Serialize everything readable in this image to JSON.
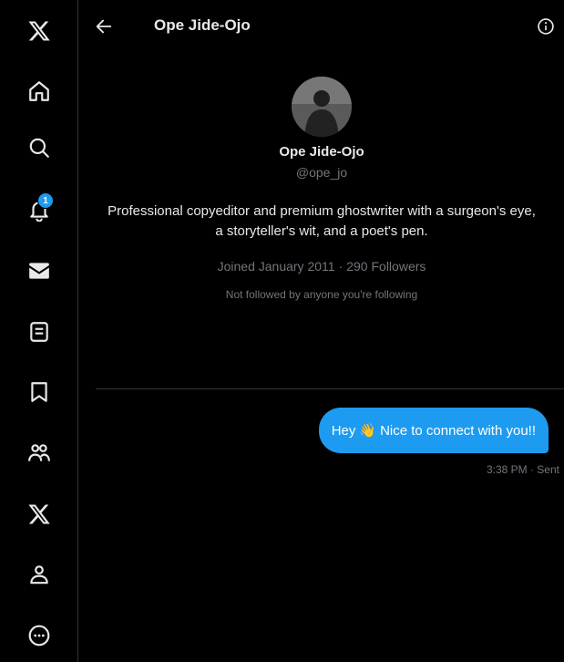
{
  "sidebar": {
    "items": [
      {
        "icon": "x-logo-icon"
      },
      {
        "icon": "home-icon"
      },
      {
        "icon": "search-icon"
      },
      {
        "icon": "notifications-icon",
        "badge": "1"
      },
      {
        "icon": "messages-icon"
      },
      {
        "icon": "lists-icon"
      },
      {
        "icon": "bookmarks-icon"
      },
      {
        "icon": "communities-icon"
      },
      {
        "icon": "premium-x-icon"
      },
      {
        "icon": "profile-icon"
      },
      {
        "icon": "more-icon"
      }
    ]
  },
  "header": {
    "title": "Ope Jide-Ojo"
  },
  "profile": {
    "name": "Ope Jide-Ojo",
    "handle": "@ope_jo",
    "bio": "Professional copyeditor and premium ghostwriter with a surgeon's eye, a storyteller's wit, and a poet's pen.",
    "joined": "Joined January 2011",
    "separator": "·",
    "followers": "290 Followers",
    "not_followed": "Not followed by anyone you're following"
  },
  "message": {
    "prefix": "Hey",
    "emoji": "👋",
    "suffix": "Nice to connect with you!!",
    "meta": "3:38 PM · Sent"
  },
  "colors": {
    "accent": "#1d9bf0",
    "background": "#000000",
    "secondary_text": "#71767b",
    "border": "#2f3336"
  }
}
